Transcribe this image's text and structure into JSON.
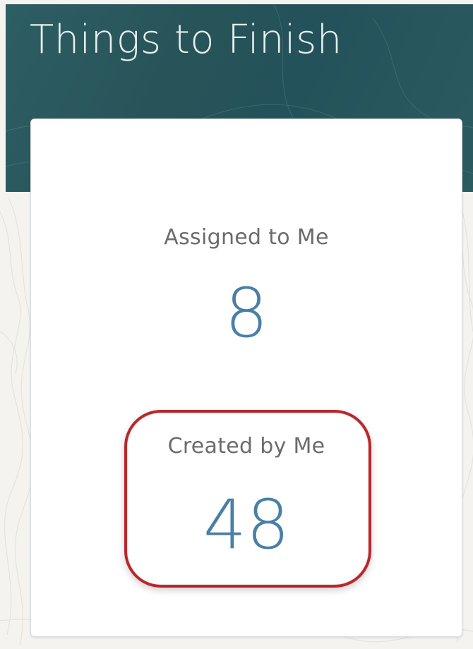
{
  "header": {
    "title": "Things to Finish"
  },
  "card": {
    "metrics": [
      {
        "label": "Assigned to Me",
        "value": "8"
      },
      {
        "label": "Created by Me",
        "value": "48",
        "highlighted": true
      }
    ]
  },
  "colors": {
    "header_background": "#275459",
    "title_text": "#e7efef",
    "metric_value": "#4a7fa6",
    "metric_label": "#6b6b6b",
    "highlight_ring": "#b8282b"
  }
}
